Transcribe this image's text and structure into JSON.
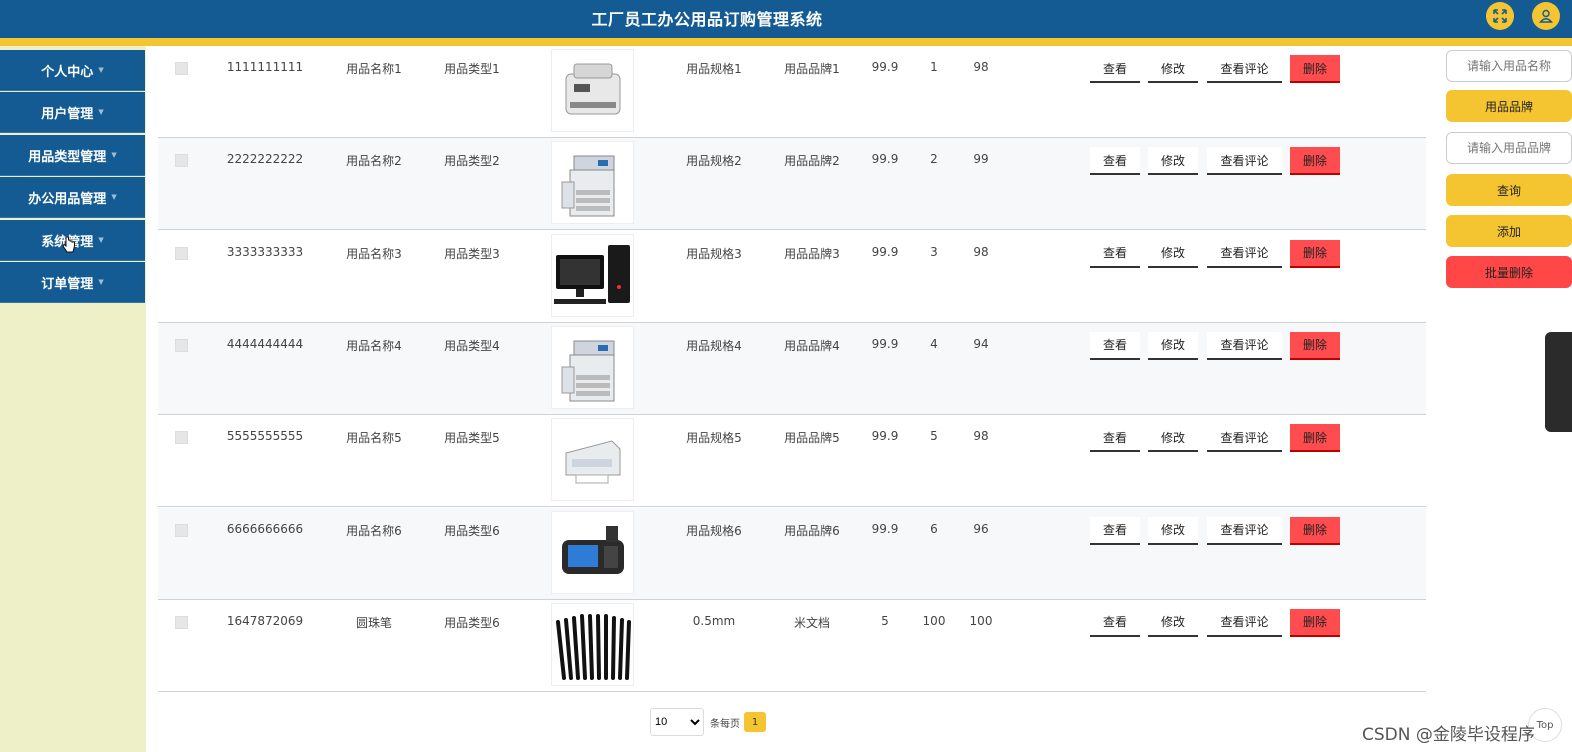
{
  "app": {
    "title": "工厂员工办公用品订购管理系统"
  },
  "sidebar": {
    "items": [
      {
        "label": "个人中心"
      },
      {
        "label": "用户管理"
      },
      {
        "label": "用品类型管理"
      },
      {
        "label": "办公用品管理"
      },
      {
        "label": "系统管理"
      },
      {
        "label": "订单管理"
      }
    ]
  },
  "actions": {
    "view": "查看",
    "edit": "修改",
    "comments": "查看评论",
    "delete": "删除"
  },
  "rows": [
    {
      "code": "1111111111",
      "name": "用品名称1",
      "type": "用品类型1",
      "image_icon": "money-counter-icon",
      "spec": "用品规格1",
      "brand": "用品品牌1",
      "price": "99.9",
      "qty": "1",
      "score": "98"
    },
    {
      "code": "2222222222",
      "name": "用品名称2",
      "type": "用品类型2",
      "image_icon": "copier-icon",
      "spec": "用品规格2",
      "brand": "用品品牌2",
      "price": "99.9",
      "qty": "2",
      "score": "99"
    },
    {
      "code": "3333333333",
      "name": "用品名称3",
      "type": "用品类型3",
      "image_icon": "desktop-computer-icon",
      "spec": "用品规格3",
      "brand": "用品品牌3",
      "price": "99.9",
      "qty": "3",
      "score": "98"
    },
    {
      "code": "4444444444",
      "name": "用品名称4",
      "type": "用品类型4",
      "image_icon": "copier-icon",
      "spec": "用品规格4",
      "brand": "用品品牌4",
      "price": "99.9",
      "qty": "4",
      "score": "94"
    },
    {
      "code": "5555555555",
      "name": "用品名称5",
      "type": "用品类型5",
      "image_icon": "printer-icon",
      "spec": "用品规格5",
      "brand": "用品品牌5",
      "price": "99.9",
      "qty": "5",
      "score": "98"
    },
    {
      "code": "6666666666",
      "name": "用品名称6",
      "type": "用品类型6",
      "image_icon": "pos-terminal-icon",
      "spec": "用品规格6",
      "brand": "用品品牌6",
      "price": "99.9",
      "qty": "6",
      "score": "96"
    },
    {
      "code": "1647872069",
      "name": "圆珠笔",
      "type": "用品类型6",
      "image_icon": "pens-icon",
      "spec": "0.5mm",
      "brand": "米文档",
      "price": "5",
      "qty": "100",
      "score": "100"
    }
  ],
  "pagination": {
    "page_size": "10",
    "per_page_label": "条每页",
    "current_page": "1"
  },
  "search": {
    "name_placeholder": "请输入用品名称",
    "brand_label": "用品品牌",
    "brand_placeholder": "请输入用品品牌",
    "query": "查询",
    "add": "添加",
    "batch_delete": "批量删除"
  },
  "floating": {
    "top_label": "Top"
  },
  "watermark": "CSDN @金陵毕设程序",
  "colors": {
    "header": "#135b92",
    "accent": "#f5c531",
    "danger": "#ff4d4f",
    "sidebar_bg": "#eef0c8"
  }
}
